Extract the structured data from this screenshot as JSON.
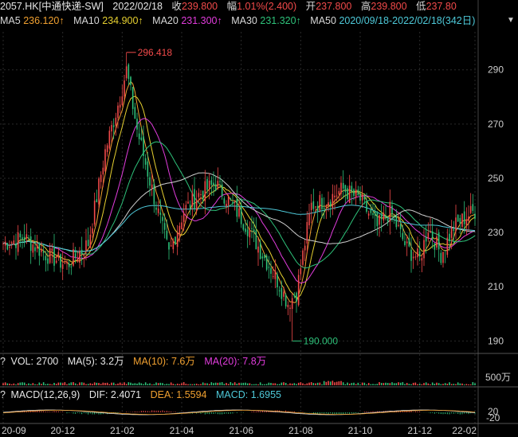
{
  "header": {
    "symbol": "2057.HK[中通快递-SW]",
    "date": "2022/02/18",
    "close_label": "收",
    "close": "239.800",
    "change_label": "幅",
    "change": "1.01%(2.400)",
    "open_label": "开",
    "open": "237.800",
    "high_label": "高",
    "high": "239.800",
    "low_label": "低",
    "low": "237.80"
  },
  "ma": {
    "ma5_label": "MA5",
    "ma5": "236.120↑",
    "ma10_label": "MA10",
    "ma10": "234.900↑",
    "ma20_label": "MA20",
    "ma20": "231.300↑",
    "ma30_label": "MA30",
    "ma30": "231.320↑",
    "ma50_label": "MA50",
    "range_text": "2020/09/18-2022/02/18(342日)"
  },
  "volume": {
    "q": "?",
    "label": "VOL: 2700",
    "ma5": "MA(5): 3.2万",
    "ma10": "MA(10): 7.6万",
    "ma20": "MA(20): 7.8万",
    "axis_top": "500万"
  },
  "macd": {
    "q": "?",
    "label": "MACD(12,26,9)",
    "dif": "DIF: 2.4071",
    "dea": "DEA: 1.5594",
    "macd": "MACD: 1.6955",
    "axis_top": "20",
    "axis_bottom": "-20"
  },
  "colors": {
    "up": "#f24a4a",
    "down": "#2ec27a",
    "ma5": "#f0a030",
    "ma10": "#e6d030",
    "ma20": "#e23cdd",
    "ma30": "#2ec27a",
    "ma50": "#d0d0d0",
    "ma120": "#4ec9d9"
  },
  "chart_data": {
    "type": "candlestick",
    "y_ticks": [
      "290",
      "270",
      "250",
      "230",
      "210",
      "190"
    ],
    "ylim": [
      186,
      304
    ],
    "x_tick_labels": [
      "20-09",
      "20-12",
      "21-02",
      "21-04",
      "21-06",
      "21-08",
      "21-10",
      "21-12",
      "22-02"
    ],
    "annotations": [
      {
        "text": "296.418",
        "value": 296.418,
        "x_index": 58
      },
      {
        "text": "190.000",
        "value": 190.0,
        "x_index": 136
      }
    ],
    "close_series_anchors": [
      [
        0,
        226
      ],
      [
        10,
        228
      ],
      [
        20,
        222
      ],
      [
        30,
        218
      ],
      [
        40,
        226
      ],
      [
        48,
        260
      ],
      [
        55,
        280
      ],
      [
        58,
        290
      ],
      [
        63,
        268
      ],
      [
        70,
        246
      ],
      [
        78,
        222
      ],
      [
        85,
        238
      ],
      [
        92,
        244
      ],
      [
        100,
        248
      ],
      [
        108,
        240
      ],
      [
        115,
        232
      ],
      [
        122,
        222
      ],
      [
        128,
        214
      ],
      [
        134,
        204
      ],
      [
        138,
        208
      ],
      [
        145,
        240
      ],
      [
        152,
        242
      ],
      [
        160,
        246
      ],
      [
        168,
        242
      ],
      [
        176,
        232
      ],
      [
        182,
        238
      ],
      [
        190,
        224
      ],
      [
        196,
        220
      ],
      [
        200,
        232
      ],
      [
        206,
        222
      ],
      [
        212,
        232
      ],
      [
        218,
        236
      ],
      [
        222,
        238
      ]
    ],
    "n_bars": 223
  }
}
